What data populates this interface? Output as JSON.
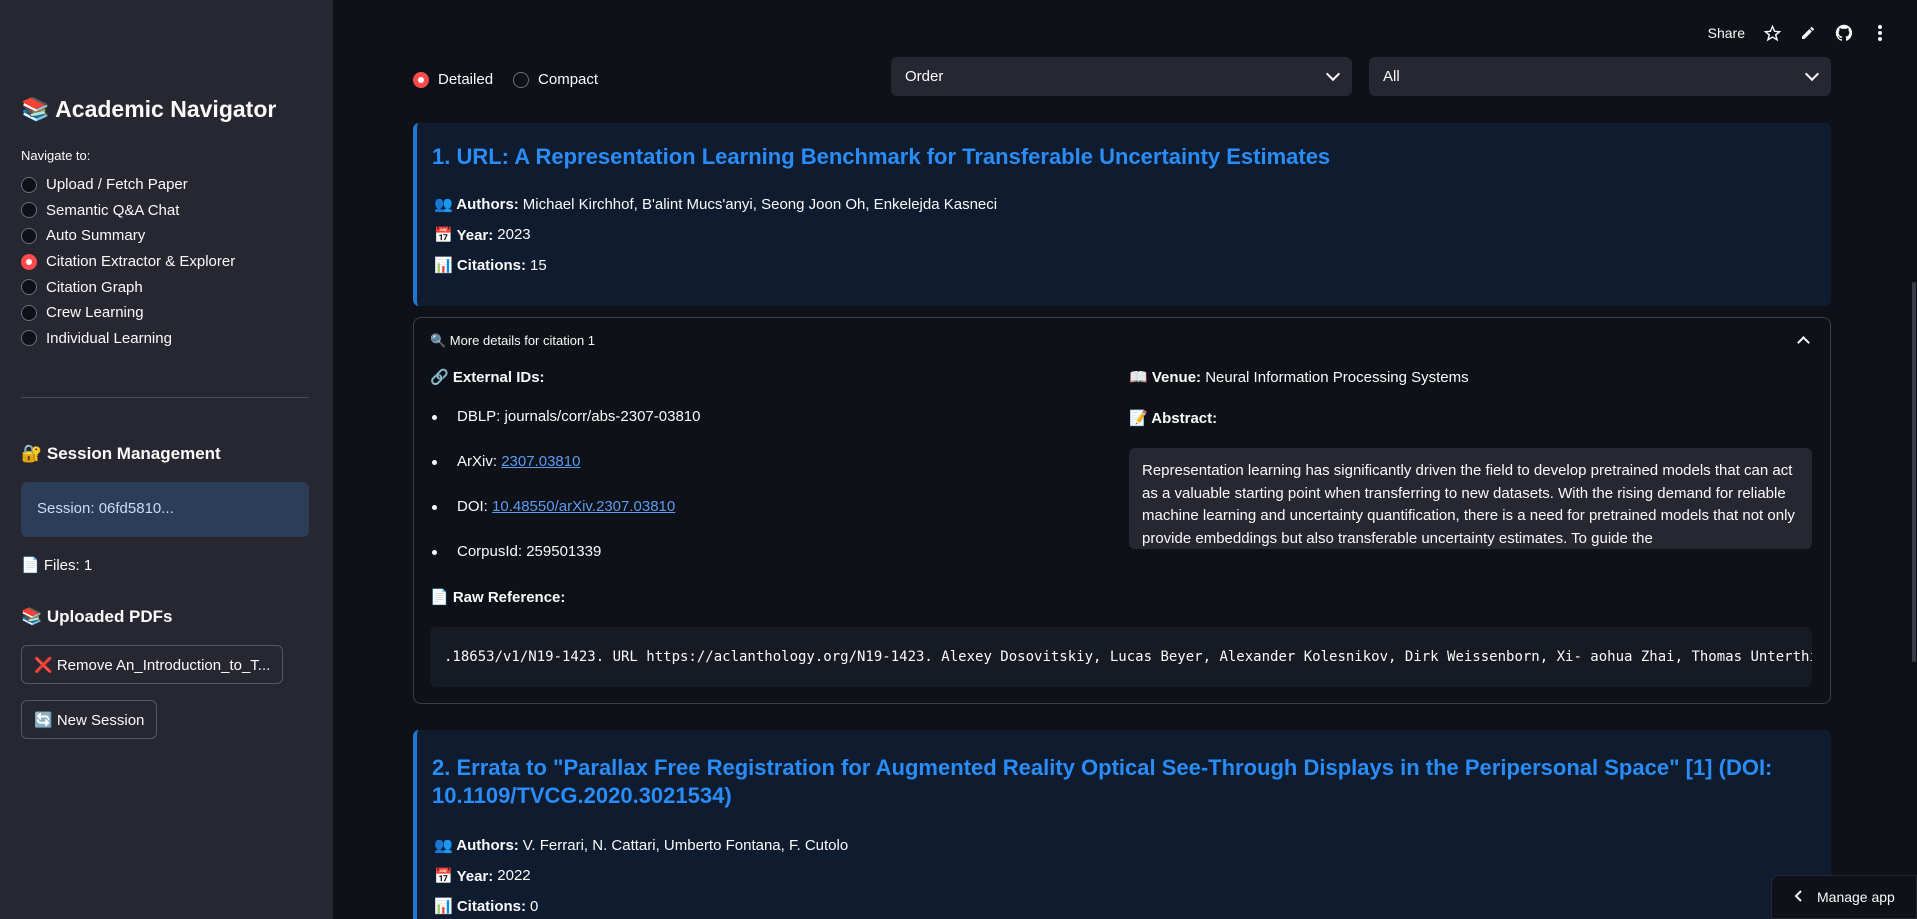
{
  "sidebar": {
    "title": "📚 Academic Navigator",
    "nav_caption": "Navigate to:",
    "nav_items": [
      {
        "label": "Upload / Fetch Paper",
        "selected": false
      },
      {
        "label": "Semantic Q&A Chat",
        "selected": false
      },
      {
        "label": "Auto Summary",
        "selected": false
      },
      {
        "label": "Citation Extractor & Explorer",
        "selected": true
      },
      {
        "label": "Citation Graph",
        "selected": false
      },
      {
        "label": "Crew Learning",
        "selected": false
      },
      {
        "label": "Individual Learning",
        "selected": false
      }
    ],
    "session_title": "🔐 Session Management",
    "session_id": "Session: 06fd5810...",
    "files": "📄 Files: 1",
    "uploaded_title": "📚 Uploaded PDFs",
    "remove_button": "❌ Remove An_Introduction_to_T...",
    "new_session_button": "🔄 New Session"
  },
  "topbar": {
    "share": "Share",
    "icons": [
      "star-icon",
      "pencil-icon",
      "github-icon",
      "more-vertical-icon"
    ]
  },
  "controls": {
    "view_options": [
      {
        "label": "Detailed",
        "selected": true
      },
      {
        "label": "Compact",
        "selected": false
      }
    ],
    "sort_select": "Order",
    "filter_select": "All"
  },
  "citations": [
    {
      "title": "1. URL: A Representation Learning Benchmark for Transferable Uncertainty Estimates",
      "authors_label": "👥 Authors:",
      "authors": "Michael Kirchhof, B'alint Mucs'anyi, Seong Joon Oh, Enkelejda Kasneci",
      "year_label": "📅 Year:",
      "year": "2023",
      "citations_label": "📊 Citations:",
      "citations": "15"
    },
    {
      "title": "2. Errata to \"Parallax Free Registration for Augmented Reality Optical See-Through Displays in the Peripersonal Space\" [1] (DOI: 10.1109/TVCG.2020.3021534)",
      "authors_label": "👥 Authors:",
      "authors": "V. Ferrari, N. Cattari, Umberto Fontana, F. Cutolo",
      "year_label": "📅 Year:",
      "year": "2022",
      "citations_label": "📊 Citations:",
      "citations": "0"
    }
  ],
  "details": {
    "header": "🔍 More details for citation 1",
    "external_ids_label": "🔗 External IDs:",
    "ids": [
      {
        "prefix": "DBLP: ",
        "value": "journals/corr/abs-2307-03810",
        "link": false
      },
      {
        "prefix": "ArXiv: ",
        "value": "2307.03810",
        "link": true
      },
      {
        "prefix": "DOI: ",
        "value": "10.48550/arXiv.2307.03810",
        "link": true
      },
      {
        "prefix": "CorpusId: ",
        "value": "259501339",
        "link": false
      }
    ],
    "venue_label": "📖 Venue:",
    "venue": "Neural Information Processing Systems",
    "abstract_label": "📝 Abstract:",
    "abstract": "Representation learning has significantly driven the field to develop pretrained models that can act as a valuable starting point when transferring to new datasets. With the rising demand for reliable machine learning and uncertainty quantification, there is a need for pretrained models that not only provide embeddings but also transferable uncertainty estimates. To guide the",
    "raw_label": "📄 Raw Reference:",
    "raw": ".18653/v1/N19-1423. URL https://aclanthology.org/N19-1423. Alexey Dosovitskiy, Lucas Beyer, Alexander Kolesnikov, Dirk Weissenborn, Xi- aohua Zhai, Thomas Unterthi"
  },
  "manage_app": "Manage app"
}
